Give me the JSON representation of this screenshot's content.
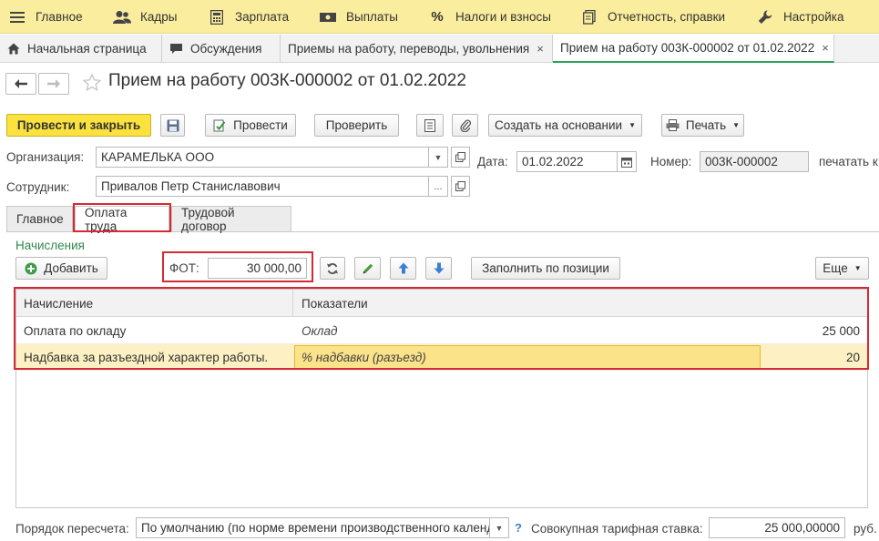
{
  "menu": [
    {
      "label": "Главное",
      "icon": "hamburger-icon"
    },
    {
      "label": "Кадры",
      "icon": "users-icon"
    },
    {
      "label": "Зарплата",
      "icon": "calculator-icon"
    },
    {
      "label": "Выплаты",
      "icon": "cash-icon"
    },
    {
      "label": "Налоги и взносы",
      "icon": "percent-icon"
    },
    {
      "label": "Отчетность, справки",
      "icon": "reports-icon"
    },
    {
      "label": "Настройка",
      "icon": "wrench-icon"
    }
  ],
  "tabs": [
    {
      "label": "Начальная страница",
      "icon": "home-icon"
    },
    {
      "label": "Обсуждения",
      "icon": "chat-icon"
    },
    {
      "label": "Приемы на работу, переводы, увольнения",
      "close": "×"
    },
    {
      "label": "Прием на работу 003К-000002 от 01.02.2022",
      "close": "×"
    }
  ],
  "document": {
    "title": "Прием на работу 003К-000002 от 01.02.2022"
  },
  "toolbar": {
    "post_close": "Провести и закрыть",
    "post": "Провести",
    "check": "Проверить",
    "create_based": "Создать на основании",
    "print": "Печать"
  },
  "form": {
    "org_label": "Организация:",
    "org_value": "КАРАМЕЛЬКА ООО",
    "date_label": "Дата:",
    "date_value": "01.02.2022",
    "number_label": "Номер:",
    "number_value": "003К-000002",
    "print_label": "печатать к",
    "employee_label": "Сотрудник:",
    "employee_value": "Привалов Петр Станиславович",
    "dots": "..."
  },
  "form_tabs": [
    "Главное",
    "Оплата труда",
    "Трудовой договор"
  ],
  "payroll": {
    "section_title": "Начисления",
    "add_button": "Добавить",
    "fot_label": "ФОТ:",
    "fot_value": "30 000,00",
    "fill_button": "Заполнить по позиции",
    "more_button": "Еще"
  },
  "table": {
    "columns": [
      "Начисление",
      "Показатели"
    ],
    "rows": [
      {
        "accrual": "Оплата по окладу",
        "indicator": "Оклад",
        "value": "25 000"
      },
      {
        "accrual": "Надбавка за разъездной характер работы.",
        "indicator": "% надбавки (разъезд)",
        "value": "20"
      }
    ]
  },
  "footer": {
    "recalc_label": "Порядок пересчета:",
    "recalc_value": "По умолчанию (по норме времени производственного календ",
    "help": "?",
    "rate_label": "Совокупная тарифная ставка:",
    "rate_value": "25 000,00000",
    "currency": "руб."
  },
  "colors": {
    "menu_bg": "#fbed9e",
    "primary_button": "#fbe23f",
    "highlight": "#d42a36",
    "selected_row": "#fdf1c3",
    "section_green": "#2f8a4b"
  }
}
